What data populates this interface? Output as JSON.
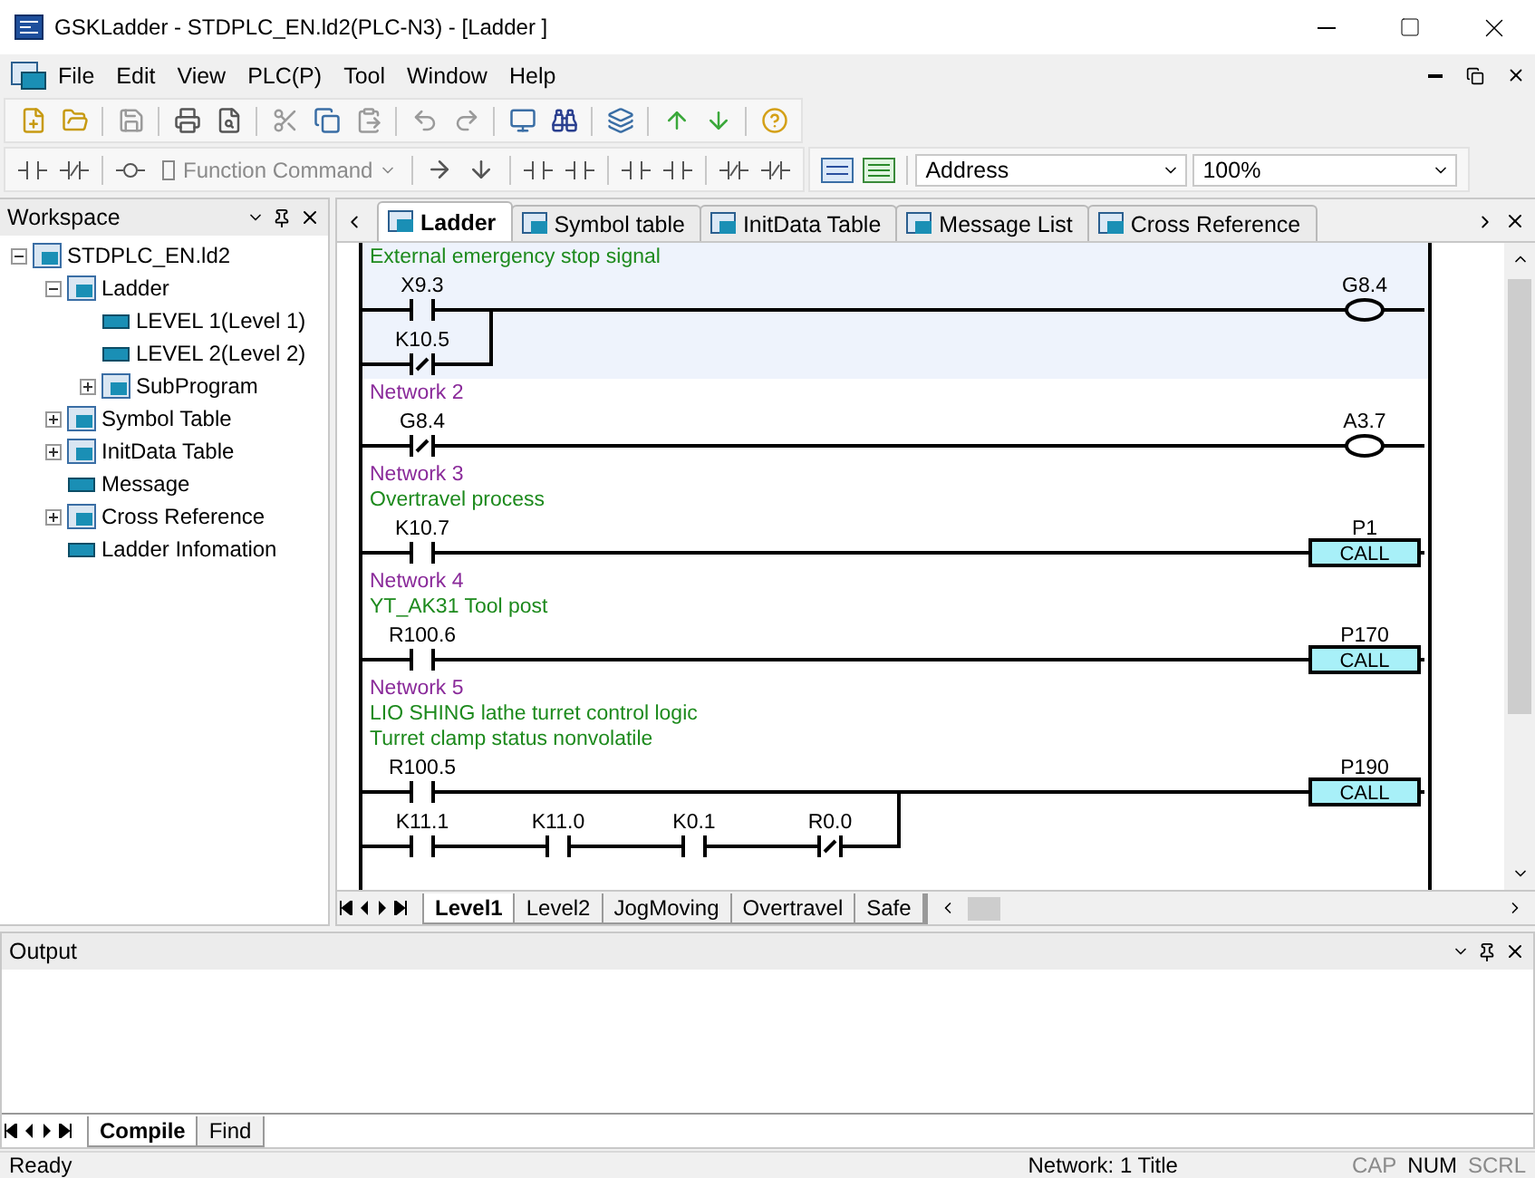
{
  "window": {
    "title": "GSKLadder - STDPLC_EN.ld2(PLC-N3) - [Ladder ]"
  },
  "menu": [
    "File",
    "Edit",
    "View",
    "PLC(P)",
    "Tool",
    "Window",
    "Help"
  ],
  "toolbar": {
    "function_command": {
      "label": "Function Command",
      "disabled": true
    },
    "address": "Address",
    "zoom": "100%"
  },
  "workspace": {
    "title": "Workspace",
    "tree": [
      {
        "label": "STDPLC_EN.ld2",
        "expanded": true,
        "children": [
          {
            "label": "Ladder",
            "expanded": true,
            "children": [
              {
                "label": "LEVEL 1(Level 1)"
              },
              {
                "label": "LEVEL 2(Level 2)"
              },
              {
                "label": "SubProgram",
                "expanded": false
              }
            ]
          },
          {
            "label": "Symbol Table",
            "expanded": false
          },
          {
            "label": "InitData Table",
            "expanded": false
          },
          {
            "label": "Message"
          },
          {
            "label": "Cross Reference",
            "expanded": false
          },
          {
            "label": "Ladder Infomation"
          }
        ]
      }
    ]
  },
  "doc_tabs": [
    {
      "label": "Ladder",
      "selected": true
    },
    {
      "label": "Symbol table",
      "selected": false
    },
    {
      "label": "InitData Table",
      "selected": false
    },
    {
      "label": "Message List",
      "selected": false
    },
    {
      "label": "Cross Reference",
      "selected": false
    }
  ],
  "networks": [
    {
      "selected": true,
      "comments": [
        "External emergency stop signal"
      ],
      "rows": [
        [
          {
            "label": "X9.3",
            "kind": "no"
          }
        ],
        [
          {
            "label": "K10.5",
            "kind": "nc"
          }
        ]
      ],
      "output": {
        "kind": "coil",
        "label": "G8.4"
      }
    },
    {
      "selected": false,
      "title": "Network 2",
      "rows": [
        [
          {
            "label": "G8.4",
            "kind": "nc"
          }
        ]
      ],
      "output": {
        "kind": "coil",
        "label": "A3.7"
      }
    },
    {
      "selected": false,
      "title": "Network 3",
      "comments": [
        "Overtravel process"
      ],
      "rows": [
        [
          {
            "label": "K10.7",
            "kind": "no"
          }
        ]
      ],
      "output": {
        "kind": "call",
        "label": "P1",
        "text": "CALL"
      }
    },
    {
      "selected": false,
      "title": "Network 4",
      "comments": [
        "YT_AK31 Tool post"
      ],
      "rows": [
        [
          {
            "label": "R100.6",
            "kind": "no"
          }
        ]
      ],
      "output": {
        "kind": "call",
        "label": "P170",
        "text": "CALL"
      }
    },
    {
      "selected": false,
      "title": "Network 5",
      "comments": [
        "LIO SHING lathe turret control logic",
        "Turret clamp status nonvolatile"
      ],
      "rows": [
        [
          {
            "label": "R100.5",
            "kind": "no"
          }
        ],
        [
          {
            "label": "K11.1",
            "kind": "no"
          },
          {
            "label": "K11.0",
            "kind": "no"
          },
          {
            "label": "K0.1",
            "kind": "no"
          },
          {
            "label": "R0.0",
            "kind": "nc"
          }
        ]
      ],
      "output": {
        "kind": "call",
        "label": "P190",
        "text": "CALL"
      }
    }
  ],
  "sheet_tabs": [
    {
      "label": "Level1",
      "selected": true
    },
    {
      "label": "Level2",
      "selected": false
    },
    {
      "label": "JogMoving",
      "selected": false
    },
    {
      "label": "Overtravel",
      "selected": false
    },
    {
      "label": "Safe",
      "selected": false
    }
  ],
  "output": {
    "title": "Output",
    "tabs": [
      {
        "label": "Compile",
        "selected": true
      },
      {
        "label": "Find",
        "selected": false
      }
    ]
  },
  "status": {
    "message": "Ready",
    "network": "Network: 1 Title",
    "indicators": [
      {
        "label": "CAP",
        "on": false
      },
      {
        "label": "NUM",
        "on": true
      },
      {
        "label": "SCRL",
        "on": false
      }
    ]
  }
}
